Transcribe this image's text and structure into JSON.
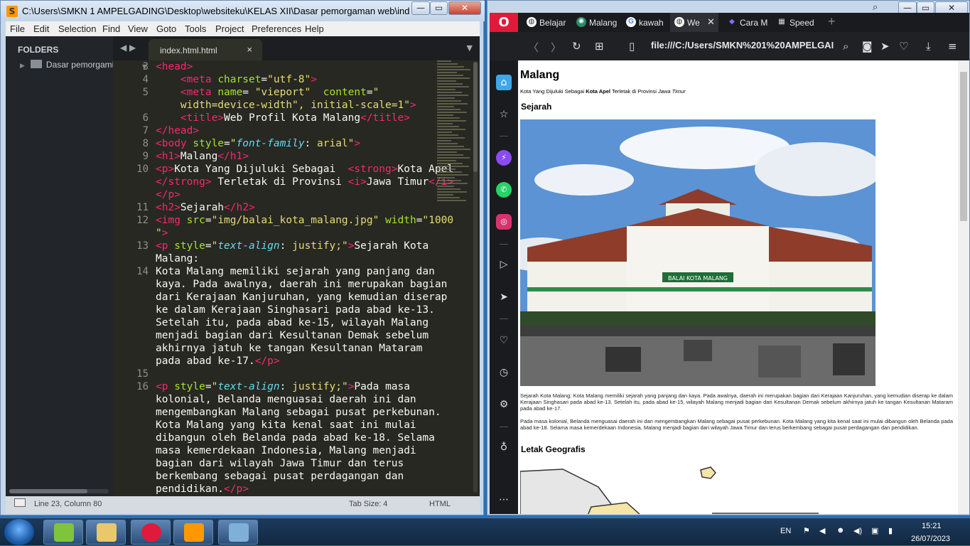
{
  "sublime": {
    "title": "C:\\Users\\SMKN 1 AMPELGADING\\Desktop\\websiteku\\KELAS XII\\Dasar pemorgaman web\\index.html...",
    "menu": [
      "File",
      "Edit",
      "Selection",
      "Find",
      "View",
      "Goto",
      "Tools",
      "Project",
      "Preferences",
      "Help"
    ],
    "folders_header": "FOLDERS",
    "folder_item": "Dasar pemorgami",
    "tab_name": "index.html.html",
    "status": {
      "position": "Line 23, Column 80",
      "tab_size": "Tab Size: 4",
      "syntax": "HTML"
    },
    "line_numbers": [
      "3",
      "4",
      "5",
      "",
      "6",
      "7",
      "8",
      "9",
      "10",
      "",
      "",
      "11",
      "12",
      "",
      "13",
      "",
      "14",
      "",
      "",
      "",
      "",
      "",
      "",
      "",
      "15",
      "16",
      "",
      "",
      "",
      "",
      "",
      "",
      "",
      ""
    ]
  },
  "opera": {
    "tabs": [
      "Belajar",
      "Malang",
      "kawah",
      "We",
      "Cara M",
      "Speed"
    ],
    "url": "file:///C:/Users/SMKN%201%20AMPELGAI"
  },
  "page": {
    "h1": "Malang",
    "subtitle_pre": "Kota Yang Dijuluki Sebagai ",
    "subtitle_strong": "Kota Apel",
    "subtitle_mid": " Terletak di Provinsi ",
    "subtitle_italic": "Jawa Timur",
    "h2_sejarah": "Sejarah",
    "photo_sign": "BALAI KOTA MALANG",
    "p1": "Sejarah Kota Malang: Kota Malang memiliki sejarah yang panjang dan kaya. Pada awalnya, daerah ini merupakan bagian dari Kerajaan Kanjuruhan, yang kemudian diserap ke dalam Kerajaan Singhasari pada abad ke-13. Setelah itu, pada abad ke-15, wilayah Malang menjadi bagian dari Kesultanan Demak sebelum akhirnya jatuh ke tangan Kesultanan Mataram pada abad ke-17.",
    "p2": "Pada masa kolonial, Belanda menguasai daerah ini dan mengembangkan Malang sebagai pusat perkebunan. Kota Malang yang kita kenal saat ini mulai dibangun oleh Belanda pada abad ke-18. Selama masa kemerdekaan Indonesia, Malang menjadi bagian dari wilayah Jawa Timur dan terus berkembang sebagai pusat perdagangan dan pendidikan.",
    "h2_geo": "Letak Geografis"
  },
  "taskbar": {
    "lang": "EN",
    "time": "15:21",
    "date": "26/07/2023"
  },
  "colors": {
    "opera_red": "#e01a3a",
    "sublime_bg": "#272822",
    "tag": "#f92672",
    "attr": "#a6e22e",
    "string": "#e6db74"
  }
}
